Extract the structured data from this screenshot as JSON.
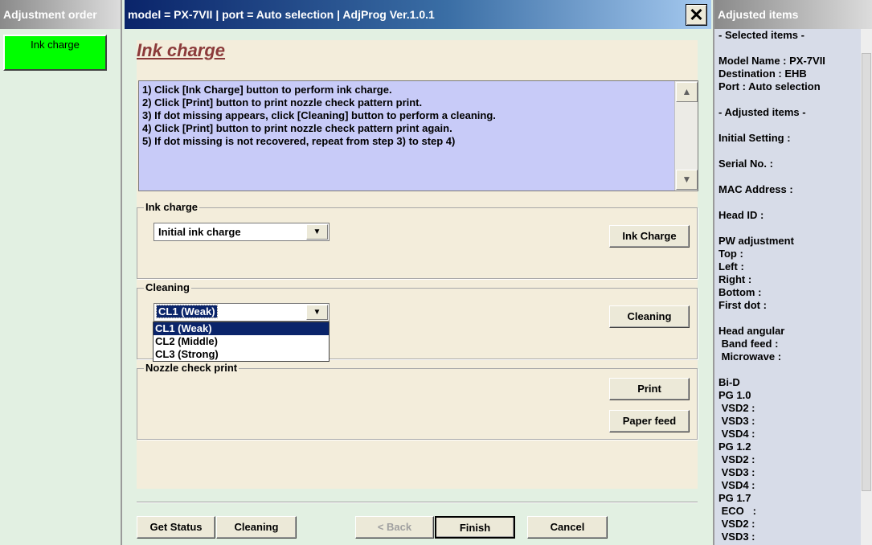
{
  "left_panel": {
    "header": "Adjustment order",
    "steps": [
      {
        "label": "Ink charge"
      }
    ]
  },
  "dialog": {
    "title": "model = PX-7VII  |  port = Auto selection  |  AdjProg Ver.1.0.1",
    "close_glyph": "✕",
    "page_title": "Ink charge",
    "instructions": [
      "1) Click [Ink Charge] button to perform ink charge.",
      "2) Click [Print] button to print nozzle check pattern print.",
      "3) If dot missing appears, click [Cleaning] button to perform a cleaning.",
      "4) Click [Print] button to print nozzle check pattern print again.",
      "5) If dot missing is not recovered, repeat from step 3) to step 4)"
    ],
    "ink_charge_group": {
      "label": "Ink charge",
      "select_value": "Initial ink charge",
      "button": "Ink Charge"
    },
    "cleaning_group": {
      "label": "Cleaning",
      "select_value": "CL1 (Weak)",
      "options": [
        "CL1 (Weak)",
        "CL2 (Middle)",
        "CL3 (Strong)"
      ],
      "button": "Cleaning"
    },
    "nozzle_group": {
      "label": "Nozzle check print",
      "print_button": "Print",
      "paper_feed_button": "Paper feed"
    },
    "bottom_buttons": {
      "get_status": "Get Status",
      "cleaning": "Cleaning",
      "back": "< Back",
      "finish": "Finish",
      "cancel": "Cancel"
    }
  },
  "right_panel": {
    "header": "Adjusted items",
    "lines": [
      "- Selected items -",
      "",
      "Model Name : PX-7VII",
      "Destination : EHB",
      "Port : Auto selection",
      "",
      "- Adjusted items -",
      "",
      "Initial Setting :",
      "",
      "Serial No. :",
      "",
      "MAC Address :",
      "",
      "Head ID :",
      "",
      "PW adjustment",
      "Top :",
      "Left :",
      "Right :",
      "Bottom :",
      "First dot :",
      "",
      "Head angular",
      " Band feed :",
      " Microwave :",
      "",
      "Bi-D",
      "PG 1.0",
      " VSD2 :",
      " VSD3 :",
      " VSD4 :",
      "PG 1.2",
      " VSD2 :",
      " VSD3 :",
      " VSD4 :",
      "PG 1.7",
      " ECO   :",
      " VSD2 :",
      " VSD3 :"
    ]
  },
  "colors": {
    "active_step": "#00ff00",
    "title_bar": "#0a246a",
    "content_bg": "#f3eddb",
    "instructions_bg": "#c8cbf8",
    "page_title": "#8b3a3a"
  }
}
